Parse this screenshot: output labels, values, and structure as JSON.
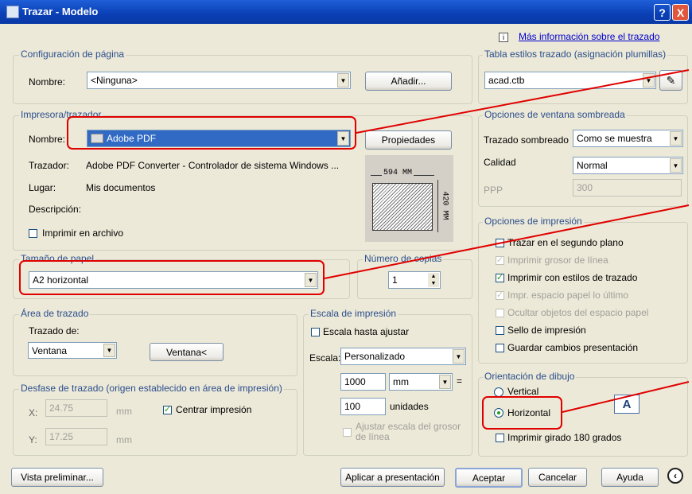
{
  "window": {
    "title": "Trazar - Modelo",
    "help_btn": "?",
    "close_btn": "X"
  },
  "info_link": "Más información sobre el trazado",
  "page_setup": {
    "group": "Configuración de página",
    "name_label": "Nombre:",
    "name_value": "<Ninguna>",
    "add_button": "Añadir..."
  },
  "printer": {
    "group": "Impresora/trazador",
    "name_label": "Nombre:",
    "name_value": "Adobe PDF",
    "properties_button": "Propiedades",
    "plotter_label": "Trazador:",
    "plotter_value": "Adobe PDF Converter - Controlador de sistema Windows ...",
    "where_label": "Lugar:",
    "where_value": "Mis documentos",
    "desc_label": "Descripción:",
    "print_to_file": "Imprimir en archivo",
    "preview_width": "594 MM",
    "preview_height": "420 MM"
  },
  "paper_size": {
    "group": "Tamaño de papel",
    "value": "A2 horizontal"
  },
  "copies": {
    "group": "Número de copias",
    "value": "1"
  },
  "plot_area": {
    "group": "Área de trazado",
    "what_label": "Trazado de:",
    "what_value": "Ventana",
    "window_button": "Ventana<"
  },
  "plot_offset": {
    "group": "Desfase de trazado (origen establecido en área de impresión)",
    "x_label": "X:",
    "x_value": "24.75",
    "y_label": "Y:",
    "y_value": "17.25",
    "unit": "mm",
    "center": "Centrar impresión"
  },
  "plot_scale": {
    "group": "Escala de impresión",
    "fit": "Escala hasta ajustar",
    "scale_label": "Escala:",
    "scale_value": "Personalizado",
    "num_value": "1000",
    "num_unit": "mm",
    "equals": "=",
    "den_value": "100",
    "den_unit": "unidades",
    "lineweights": "Ajustar escala del grosor de línea"
  },
  "plot_style": {
    "group": "Tabla estilos trazado (asignación plumillas)",
    "value": "acad.ctb"
  },
  "shaded": {
    "group": "Opciones de ventana sombreada",
    "shade_label": "Trazado sombreado",
    "shade_value": "Como se muestra",
    "quality_label": "Calidad",
    "quality_value": "Normal",
    "dpi_label": "PPP",
    "dpi_value": "300"
  },
  "plot_options": {
    "group": "Opciones de impresión",
    "items": [
      {
        "label": "Trazar en el segundo plano",
        "checked": false,
        "enabled": true
      },
      {
        "label": "Imprimir grosor de línea",
        "checked": true,
        "enabled": false
      },
      {
        "label": "Imprimir con estilos de trazado",
        "checked": true,
        "enabled": true
      },
      {
        "label": "Impr. espacio papel lo último",
        "checked": true,
        "enabled": false
      },
      {
        "label": "Ocultar objetos del espacio papel",
        "checked": false,
        "enabled": false
      },
      {
        "label": "Sello de impresión",
        "checked": false,
        "enabled": true
      },
      {
        "label": "Guardar cambios presentación",
        "checked": false,
        "enabled": true
      }
    ]
  },
  "orientation": {
    "group": "Orientación de dibujo",
    "portrait": "Vertical",
    "landscape": "Horizontal",
    "upside_down": "Imprimir girado 180 grados",
    "icon_letter": "A"
  },
  "footer": {
    "preview": "Vista preliminar...",
    "apply": "Aplicar a presentación",
    "ok": "Aceptar",
    "cancel": "Cancelar",
    "help": "Ayuda"
  }
}
